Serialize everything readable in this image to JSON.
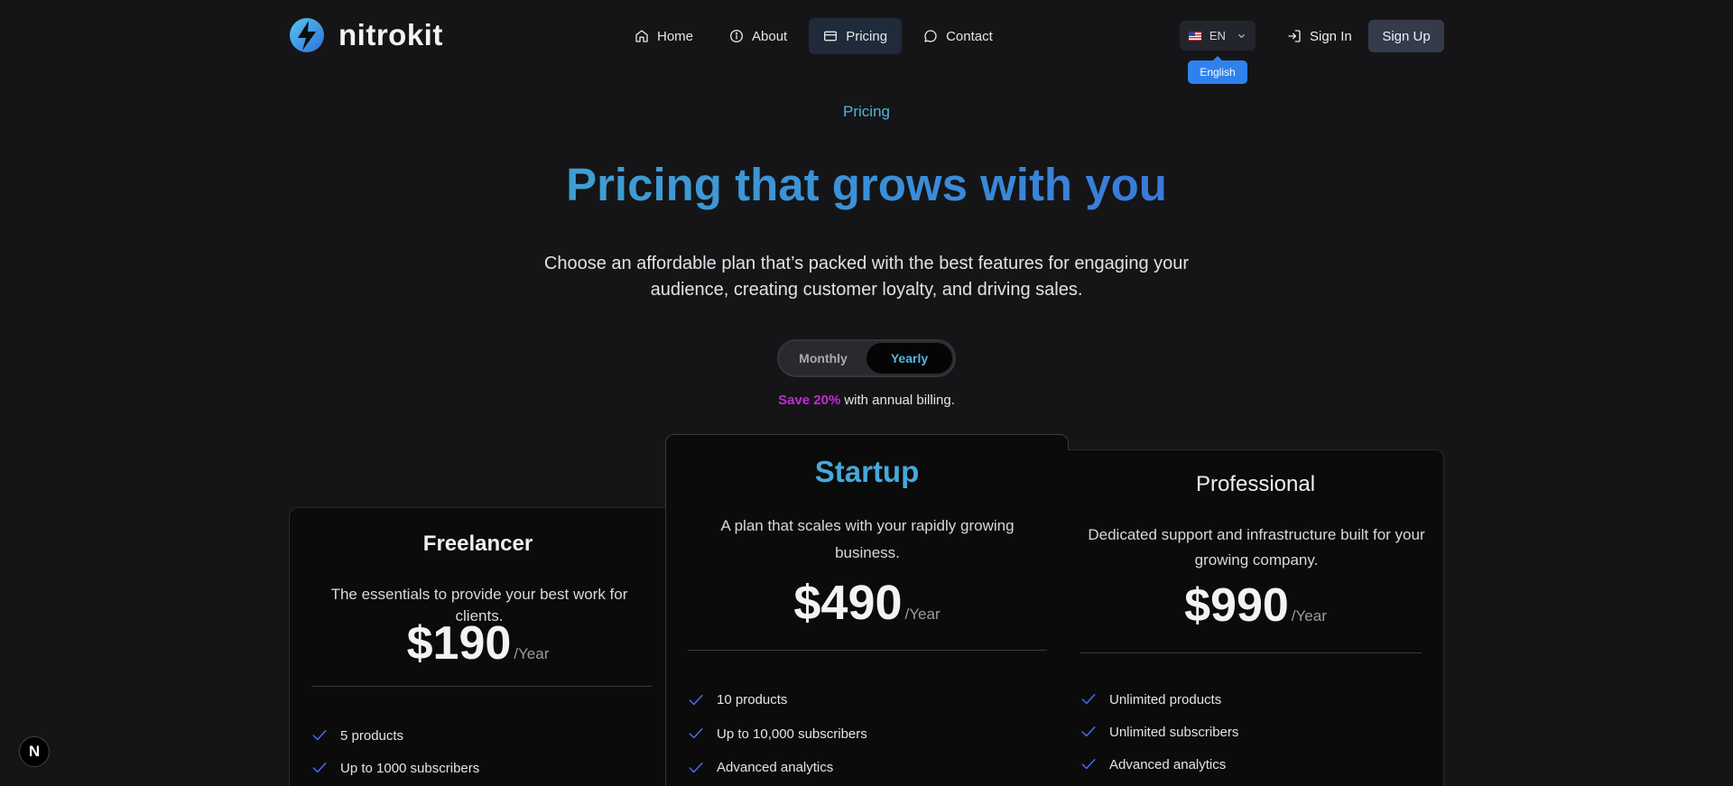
{
  "brand": {
    "name": "nitrokit",
    "logo_icon": "lightning-bolt-logo",
    "accent": "#3a8fd8"
  },
  "nav": {
    "items": [
      {
        "label": "Home",
        "icon": "home-icon"
      },
      {
        "label": "About",
        "icon": "info-icon"
      },
      {
        "label": "Pricing",
        "icon": "credit-card-icon",
        "active": true
      },
      {
        "label": "Contact",
        "icon": "message-circle-icon"
      }
    ]
  },
  "language": {
    "code": "EN",
    "tooltip": "English",
    "flag": "us-flag-icon"
  },
  "auth": {
    "sign_in": "Sign In",
    "sign_up": "Sign Up"
  },
  "hero": {
    "eyebrow": "Pricing",
    "title": "Pricing that grows with you",
    "subtitle": "Choose an affordable plan that’s packed with the best features for engaging your audience, creating customer loyalty, and driving sales."
  },
  "billing": {
    "options": [
      "Monthly",
      "Yearly"
    ],
    "selected": "Yearly",
    "save_highlight": "Save 20%",
    "save_text": "with annual billing."
  },
  "plans": [
    {
      "name": "Freelancer",
      "description": "The essentials to provide your best work for clients.",
      "price": "$190",
      "period": "/Year",
      "features": [
        "5 products",
        "Up to 1000 subscribers"
      ]
    },
    {
      "name": "Startup",
      "description": "A plan that scales with your rapidly growing business.",
      "price": "$490",
      "period": "/Year",
      "featured": true,
      "features": [
        "10 products",
        "Up to 10,000 subscribers",
        "Advanced analytics"
      ]
    },
    {
      "name": "Professional",
      "description": "Dedicated support and infrastructure built for your growing company.",
      "price": "$990",
      "period": "/Year",
      "features": [
        "Unlimited products",
        "Unlimited subscribers",
        "Advanced analytics"
      ]
    }
  ],
  "colors": {
    "background": "#151517",
    "card": "#0b0b0c",
    "check": "#4a6cf0",
    "save_highlight": "#c22bd8",
    "tooltip": "#2f82ee"
  },
  "dev_badge": {
    "label": "N"
  }
}
